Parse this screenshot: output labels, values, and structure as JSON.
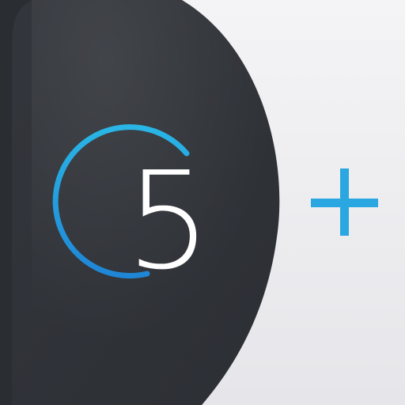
{
  "app_icon": {
    "digit": "5",
    "badge_glyph": "plus-icon",
    "colors": {
      "background_light": "#f4f4f6",
      "background_shade": "#e6e6ea",
      "dark_panel": "#33363c",
      "dark_panel_edge": "#2c2f34",
      "ring_top": "#29b6e6",
      "ring_bottom": "#1f86d6",
      "plus": "#2aa6e0",
      "digit": "#ffffff"
    }
  }
}
